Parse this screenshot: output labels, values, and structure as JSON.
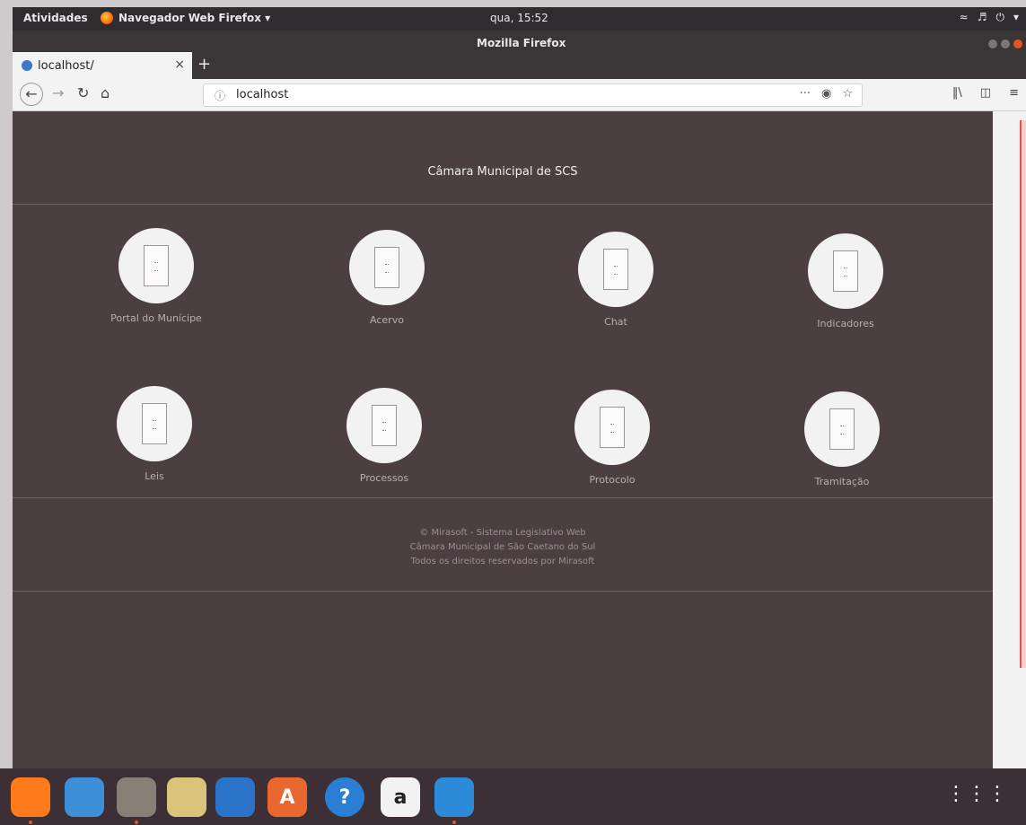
{
  "os_bar": {
    "activities": "Atividades",
    "app_menu": "Navegador Web Firefox ▾",
    "clock": "qua, 15:52",
    "sys_icons": [
      "wifi-icon",
      "volume-icon",
      "power-icon",
      "chevron-down-icon"
    ]
  },
  "window": {
    "title": "Mozilla Firefox"
  },
  "tab": {
    "label": "localhost/",
    "close": "×",
    "new_tab": "+"
  },
  "nav": {
    "url": "localhost",
    "page_actions": "···",
    "icons": [
      "back-icon",
      "forward-icon",
      "reload-icon",
      "home-icon",
      "info-icon",
      "pocket-icon",
      "bookmark-star-icon",
      "library-icon",
      "sidebar-icon",
      "menu-icon"
    ]
  },
  "page": {
    "title": "Câmara Municipal de SCS",
    "tiles": [
      {
        "label": "Portal do Munícipe"
      },
      {
        "label": "Acervo"
      },
      {
        "label": "Chat"
      },
      {
        "label": "Indicadores"
      },
      {
        "label": "Leis"
      },
      {
        "label": "Processos"
      },
      {
        "label": "Protocolo"
      },
      {
        "label": "Tramitação"
      }
    ],
    "footer": [
      "© Mirasoft - Sistema Legislativo Web",
      "Câmara Municipal de São Caetano do Sul",
      "Todos os direitos reservados por Mirasoft"
    ]
  },
  "dock": {
    "apps": [
      {
        "icon": "firefox-icon",
        "glyph": "",
        "color": "#ff7a1a"
      },
      {
        "icon": "thunderbird-icon",
        "glyph": "",
        "color": "#3d8fd8"
      },
      {
        "icon": "files-icon",
        "glyph": "",
        "color": "#8a7f76"
      },
      {
        "icon": "rhythmbox-icon",
        "glyph": "",
        "color": "#d8c47a"
      },
      {
        "icon": "libreoffice-writer-icon",
        "glyph": "",
        "color": "#2a73c8"
      },
      {
        "icon": "software-center-icon",
        "glyph": "A",
        "color": "#e9662e"
      },
      {
        "icon": "help-icon",
        "glyph": "?",
        "color": "#2a7fd4"
      },
      {
        "icon": "amazon-icon",
        "glyph": "a",
        "color": "#f2f2f2"
      },
      {
        "icon": "vscode-icon",
        "glyph": "",
        "color": "#2c8ad8"
      }
    ],
    "apps_grid": "⋮⋮⋮"
  }
}
